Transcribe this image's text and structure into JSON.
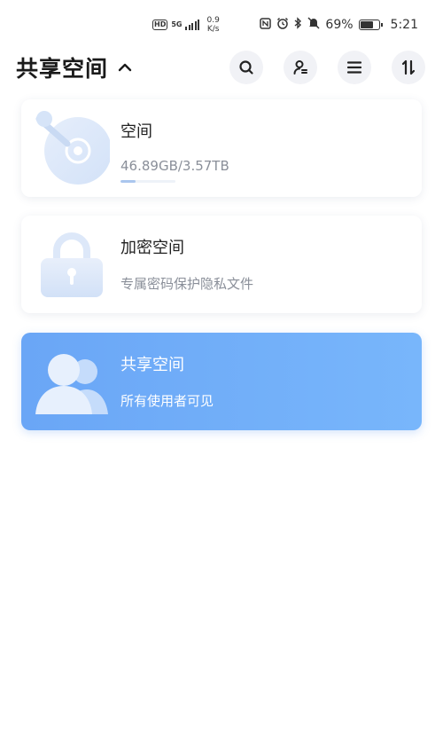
{
  "status_bar": {
    "hd": "HD",
    "network": "5G",
    "speed_value": "0.9",
    "speed_unit": "K/s",
    "battery": "69%",
    "time": "5:21",
    "icons": [
      "nfc-icon",
      "alarm-icon",
      "bluetooth-icon",
      "mute-icon",
      "battery-icon"
    ]
  },
  "header": {
    "title": "共享空间",
    "actions": [
      "search-icon",
      "user-manage-icon",
      "menu-icon",
      "sort-icon"
    ]
  },
  "cards": [
    {
      "name": "空间",
      "sub": "46.89GB/3.57TB",
      "usage_fraction": 0.28,
      "icon": "disc-icon"
    },
    {
      "name": "加密空间",
      "sub": "专属密码保护隐私文件",
      "icon": "lock-icon"
    },
    {
      "name": "共享空间",
      "sub": "所有使用者可见",
      "icon": "users-icon"
    }
  ],
  "colors": {
    "accent": "#6aa6f6",
    "icon_light": "#dbe8fb",
    "header_button_bg": "#f1f2f6"
  }
}
